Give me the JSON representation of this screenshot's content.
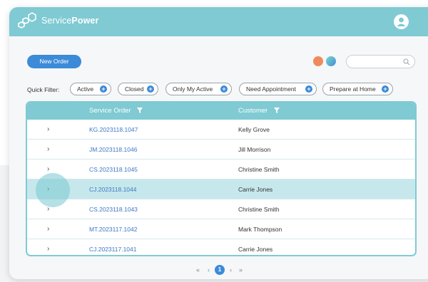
{
  "app": {
    "brand_light": "Service",
    "brand_bold": "Power"
  },
  "toolbar": {
    "new_order_label": "New Order"
  },
  "quick_filter": {
    "label": "Quick Filter:",
    "chips": [
      "Active",
      "Closed",
      "Only My Active",
      "Need Appointment",
      "Prepare at Home"
    ]
  },
  "table": {
    "columns": [
      "Service Order",
      "Customer"
    ],
    "rows": [
      {
        "order": "KG.2023118.1047",
        "customer": "Kelly Grove"
      },
      {
        "order": "JM.2023118.1046",
        "customer": "Jill Morrison"
      },
      {
        "order": "CS.2023118.1045",
        "customer": "Christine Smith"
      },
      {
        "order": "CJ.2023118.1044",
        "customer": "Carrie Jones"
      },
      {
        "order": "CS.2023118.1043",
        "customer": "Christine Smith"
      },
      {
        "order": "MT.2023117.1042",
        "customer": "Mark Thompson"
      },
      {
        "order": "CJ.2023117.1041",
        "customer": "Carrie Jones"
      }
    ],
    "selected_row": 4
  },
  "pagination": {
    "first": "«",
    "prev": "‹",
    "current": "1",
    "next": "›",
    "last": "»"
  },
  "colors": {
    "header": "#7fcad3",
    "accent": "#3b8bd8",
    "selected_row": "#c6e8ec",
    "orange_dot": "#f08a5d"
  }
}
